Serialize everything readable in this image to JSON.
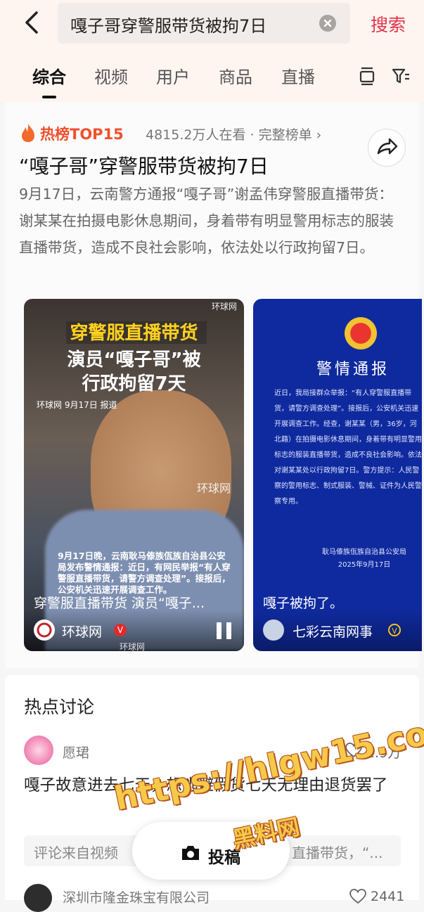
{
  "search": {
    "query": "嘎子哥穿警服带货被拘7日",
    "button": "搜索"
  },
  "tabs": [
    "综合",
    "视频",
    "用户",
    "商品",
    "直播"
  ],
  "hot": {
    "badge": "热榜TOP15",
    "viewers": "4815.2万人在看 · 完整榜单 ›",
    "headline": "“嘎子哥”穿警服带货被拘7日",
    "summary": "9月17日，云南警方通报“嘎子哥”谢孟伟穿警服直播带货：谢某某在拍摄电影休息期间，身着带有明显警用标志的服装直播带货，造成不良社会影响，依法处以行政拘留7日。"
  },
  "video1": {
    "tag": "环球网",
    "banner1": "穿警服直播带货",
    "banner2": "演员“嘎子哥”被",
    "banner3": "行政拘留7天",
    "source": "环球网 9月17日 报道",
    "watermark": "环球网",
    "news": "9月17日晚，云南耿马傣族佤族自治县公安局发布警情通报：近日，有网民举报“有人穿警服直播带货，请警方调查处理”。接报后，公安机关迅速开展调查工作。",
    "caption": "穿警服直播带货 演员“嘎子...",
    "author": "环球网",
    "watermark2": "环球网"
  },
  "video2": {
    "notice_title": "警情通报",
    "notice_body": "近日，我局接群众举报：“有人穿警服直播带货，请警方调查处理”。接报后，公安机关迅速开展调查工作。经查，谢某某（男，36岁，河北籍）在拍摄电影休息期间，身着带有明显警用标志的服装直播带货，造成不良社会影响。依法对谢某某处以行政拘留7日。警方提示：人民警察的警用标志、制式服装、警械、证件为人民警察专用。",
    "notice_sign": "耿马傣族佤族自治县公安局\n2025年9月17日",
    "caption": "嘎子被拘了。",
    "author": "七彩云南网事"
  },
  "discussion": {
    "title": "热点讨论",
    "user": "愿珺",
    "likes": "2.9万",
    "comment": "嘎子故意进去七天，想逃避假货七天无理由退货罢了",
    "source_prefix": "评论来自视频",
    "source_tail": "直播带货，“...",
    "user2": "深圳市隆金珠宝有限公司",
    "likes2": "2441"
  },
  "post_button": "投稿",
  "watermark": {
    "url": "https://hlgw15.com",
    "sub": "黑料网"
  },
  "colors": {
    "accent": "#e5334a",
    "hot": "#f0502d",
    "notice_blue": "#0f2a9e"
  }
}
